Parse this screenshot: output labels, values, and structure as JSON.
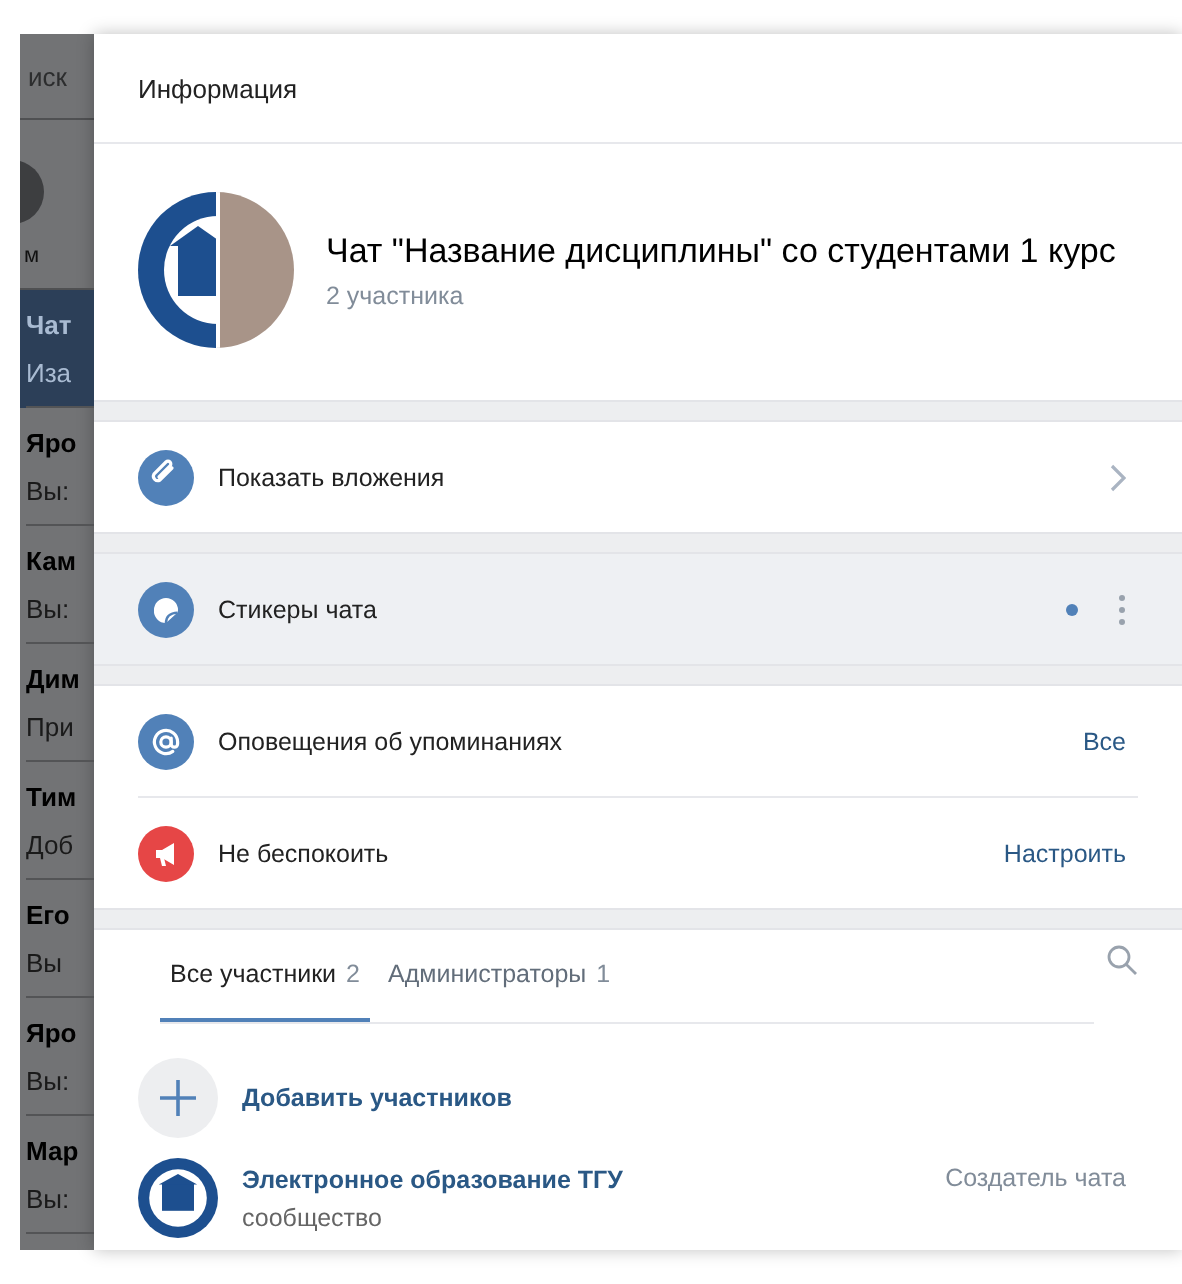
{
  "background": {
    "search_label": "иск",
    "story_label": "м",
    "chats": [
      {
        "name": "Чат",
        "preview": "Иза",
        "selected": true
      },
      {
        "name": "Яро",
        "preview": "Вы:",
        "selected": false
      },
      {
        "name": "Кам",
        "preview": "Вы:",
        "selected": false
      },
      {
        "name": "Дим",
        "preview": "При",
        "selected": false
      },
      {
        "name": "Тим",
        "preview": "Доб",
        "selected": false
      },
      {
        "name": "Его",
        "preview": "Вы",
        "selected": false
      },
      {
        "name": "Яро",
        "preview": "Вы:",
        "selected": false
      },
      {
        "name": "Мар",
        "preview": "Вы:",
        "selected": false
      }
    ]
  },
  "modal": {
    "title": "Информация",
    "chat": {
      "name": "Чат \"Название дисциплины\" со студентами 1 курс",
      "members_count": "2 участника"
    },
    "sections": [
      {
        "items": [
          {
            "kind": "link",
            "label": "Показать вложения",
            "color": "#5181b8",
            "highlighted": false
          }
        ]
      },
      {
        "items": [
          {
            "kind": "menu",
            "label": "Стикеры чата",
            "color": "#5181b8",
            "highlighted": true,
            "new_indicator": true
          }
        ]
      },
      {
        "items": [
          {
            "kind": "setting",
            "label": "Оповещения об упоминаниях",
            "color": "#5181b8",
            "highlighted": false,
            "value": "Все"
          },
          {
            "kind": "setting",
            "label": "Не беспокоить",
            "color": "#e64646",
            "highlighted": false,
            "value": "Настроить"
          }
        ]
      }
    ],
    "tabs": [
      {
        "label": "Все участники",
        "count": "2",
        "selected": true
      },
      {
        "label": "Администраторы",
        "count": "1",
        "selected": false
      }
    ],
    "add_label": "Добавить участников",
    "members": [
      {
        "name": "Электронное образование ТГУ",
        "subtitle": "сообщество",
        "role": "Создатель чата"
      }
    ]
  }
}
